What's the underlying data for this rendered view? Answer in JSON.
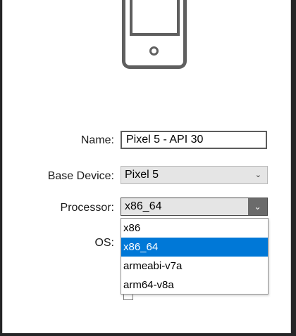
{
  "form": {
    "name_label": "Name:",
    "name_value": "Pixel 5 - API 30",
    "base_device_label": "Base Device:",
    "base_device_value": "Pixel 5",
    "processor_label": "Processor:",
    "processor_value": "x86_64",
    "os_label": "OS:"
  },
  "processor_dropdown": {
    "options": [
      "x86",
      "x86_64",
      "armeabi-v7a",
      "arm64-v8a"
    ],
    "selected": "x86_64"
  },
  "icons": {
    "device_illustration": "phone-icon",
    "dropdown_arrow": "chevron-down-icon"
  },
  "colors": {
    "selection": "#0078d7",
    "dropdown_button": "#6b6b6b",
    "phone_outline": "#5f5f5f",
    "window_background": "#252526"
  }
}
